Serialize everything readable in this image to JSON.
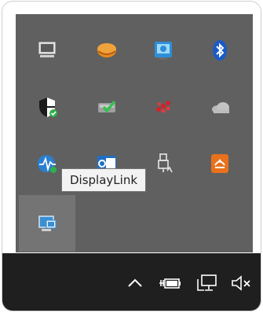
{
  "tooltip": {
    "text": "DisplayLink"
  },
  "tray_icons": [
    "display-icon",
    "storage-drive-icon",
    "network-settings-icon",
    "bluetooth-icon",
    "security-shield-icon",
    "backup-drive-icon",
    "red-app-icon",
    "cloud-icon",
    "pulse-monitor-icon",
    "outlook-icon",
    "usb-device-icon",
    "cloud-sync-icon",
    "displaylink-icon"
  ],
  "taskbar_icons": [
    "chevron-up-icon",
    "power-icon",
    "network-icon",
    "volume-muted-icon"
  ],
  "colors": {
    "flyout": "#606060",
    "taskbar": "#1f1f1f",
    "accent_orange": "#e8711c",
    "accent_blue": "#1f7ad6",
    "accent_green": "#2fb14b",
    "accent_red": "#d2222a"
  }
}
